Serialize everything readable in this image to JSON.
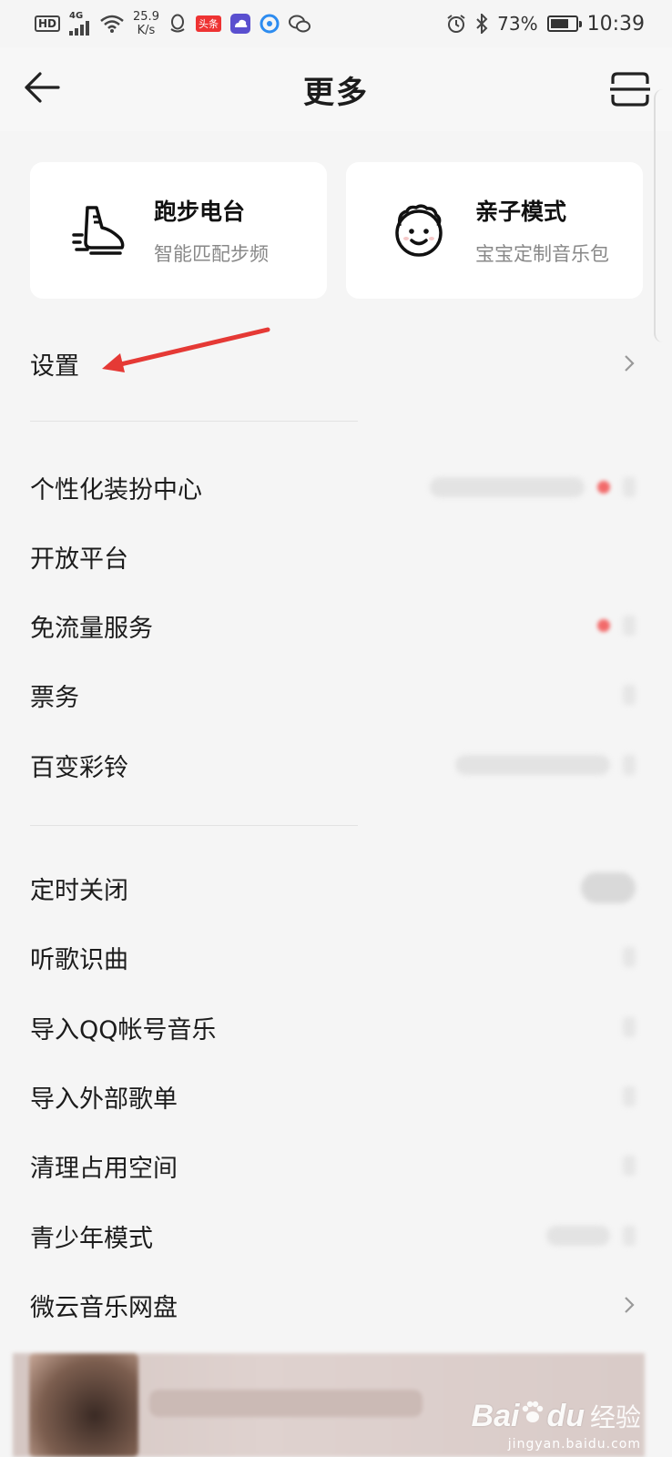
{
  "status_bar": {
    "hd": "HD",
    "network": "4G",
    "speed_value": "25.9",
    "speed_unit": "K/s",
    "toutiao": "头条",
    "battery": "73%",
    "battery_level": 0.73,
    "time": "10:39"
  },
  "header": {
    "title": "更多"
  },
  "cards": [
    {
      "title": "跑步电台",
      "subtitle": "智能匹配步频",
      "icon": "running-shoe-icon"
    },
    {
      "title": "亲子模式",
      "subtitle": "宝宝定制音乐包",
      "icon": "baby-face-icon"
    }
  ],
  "settings": {
    "label": "设置"
  },
  "group1": [
    {
      "label": "个性化装扮中心"
    },
    {
      "label": "开放平台"
    },
    {
      "label": "免流量服务"
    },
    {
      "label": "票务"
    },
    {
      "label": "百变彩铃"
    }
  ],
  "group2": [
    {
      "label": "定时关闭"
    },
    {
      "label": "听歌识曲"
    },
    {
      "label": "导入QQ帐号音乐"
    },
    {
      "label": "导入外部歌单"
    },
    {
      "label": "清理占用空间"
    },
    {
      "label": "青少年模式"
    },
    {
      "label": "微云音乐网盘"
    }
  ],
  "watermark": {
    "brand": "Bai",
    "brand_tail": "du",
    "text": "经验",
    "domain": "jingyan.baidu.com"
  },
  "colors": {
    "background": "#f5f5f5",
    "card": "#ffffff",
    "annotation_arrow": "#e53935"
  }
}
